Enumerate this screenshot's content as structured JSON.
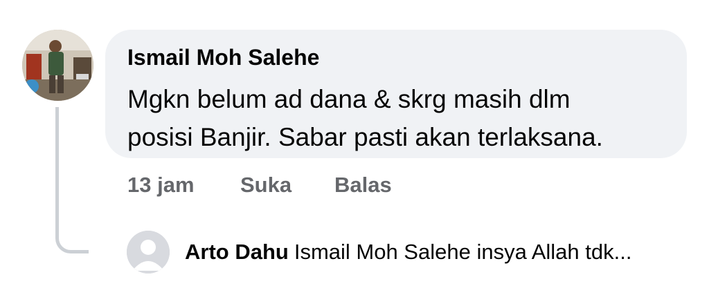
{
  "comment": {
    "author": "Ismail Moh Salehe",
    "text_line1": "Mgkn belum ad dana & skrg masih dlm",
    "text_line2": "posisi Banjir. Sabar pasti akan terlaksana.",
    "time": "13 jam",
    "like_label": "Suka",
    "reply_label": "Balas",
    "avatar_icon": "user-photo-avatar"
  },
  "reply": {
    "author": "Arto Dahu",
    "snippet": "Ismail Moh Salehe insya Allah tdk...",
    "avatar_icon": "default-user-avatar-icon"
  },
  "colors": {
    "bubble_bg": "#f0f2f5",
    "text": "#050505",
    "secondary_text": "#65676b",
    "thread_line": "#ccd0d5"
  }
}
